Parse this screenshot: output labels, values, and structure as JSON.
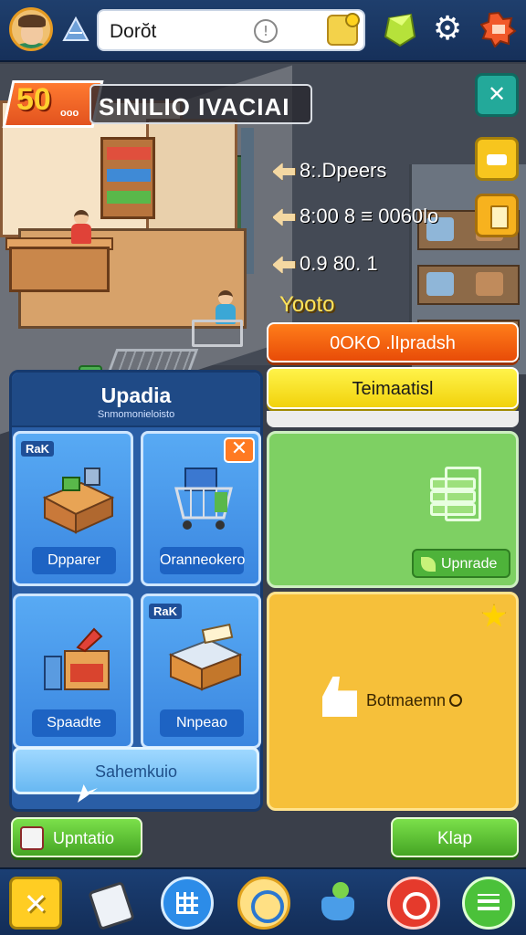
{
  "topbar": {
    "search_value": "Dorŏt"
  },
  "scene": {
    "badge_number": "50",
    "badge_sub": "ooo",
    "store_name": "SINILIO IVACIAI",
    "stats": [
      "8:.Dpeers",
      "8:00 8 ≡ 0060lo",
      "0.9 80. 1"
    ],
    "subtitle": "Yooto"
  },
  "right_buttons": {
    "orange_label": "0OKO .lIpradsh",
    "yellow_label": "Teimaatisl"
  },
  "left_panel": {
    "title": "Upadia",
    "subtitle": "Snmomonieloisto",
    "tiles": [
      {
        "tag": "RaK",
        "label": "Dpparer"
      },
      {
        "tag": "",
        "label": "Oranneokero"
      },
      {
        "tag": "",
        "label": "Spaadte"
      },
      {
        "tag": "RaK",
        "label": "Nnpeao"
      }
    ],
    "wide_button": "Sahemkuio"
  },
  "green_panel": {
    "upgrade_label": "Upnrade"
  },
  "orange_panel": {
    "text": "Botmaemn"
  },
  "actions": {
    "left_label": "Upntatio",
    "right_label": "Klap"
  },
  "colors": {
    "accent_orange": "#e84c08",
    "accent_yellow": "#f1d20c",
    "panel_blue": "#2a5ea6",
    "panel_green": "#7ed063",
    "panel_gold": "#f6c03a"
  }
}
